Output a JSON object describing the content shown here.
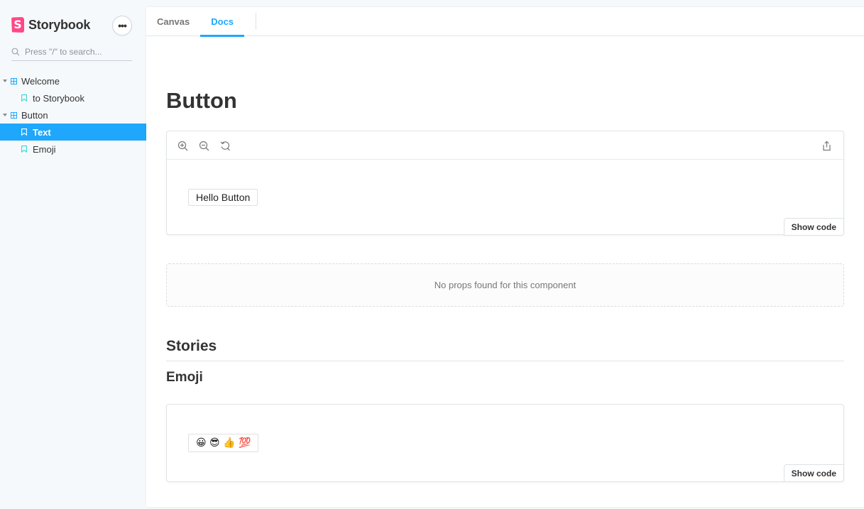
{
  "sidebar": {
    "brand": "Storybook",
    "logo_letter": "S",
    "menu_label": "•••",
    "search_placeholder": "Press \"/\" to search...",
    "tree": [
      {
        "label": "Welcome",
        "type": "group"
      },
      {
        "label": "to Storybook",
        "type": "story"
      },
      {
        "label": "Button",
        "type": "group"
      },
      {
        "label": "Text",
        "type": "story",
        "selected": true
      },
      {
        "label": "Emoji",
        "type": "story"
      }
    ]
  },
  "tabs": [
    {
      "label": "Canvas",
      "active": false
    },
    {
      "label": "Docs",
      "active": true
    }
  ],
  "docs": {
    "title": "Button",
    "primary_story": {
      "button_label": "Hello Button",
      "show_code_label": "Show code"
    },
    "props_message": "No props found for this component",
    "stories_heading": "Stories",
    "story_heading": "Emoji",
    "emoji_story": {
      "button_label": "😀 😎 👍 💯",
      "show_code_label": "Show code"
    }
  },
  "colors": {
    "accent": "#1ea7fd",
    "brand": "#ff4785",
    "sidebar_bg": "#f6f9fc"
  }
}
